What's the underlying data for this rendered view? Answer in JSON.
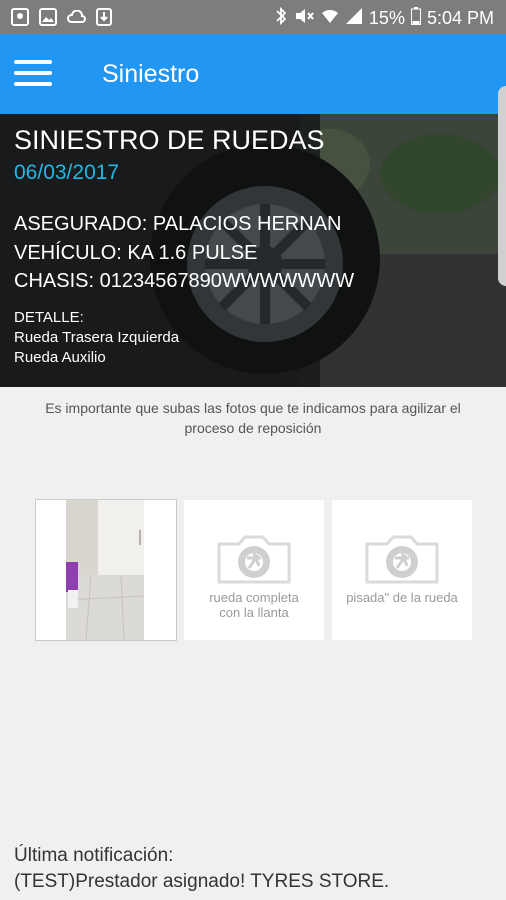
{
  "status_bar": {
    "battery": "15%",
    "time": "5:04 PM",
    "left_icons": [
      "photo-icon",
      "gallery-icon",
      "cloud-icon",
      "download-icon"
    ],
    "right_icons": [
      "bluetooth-icon",
      "mute-icon",
      "wifi-icon",
      "signal-icon",
      "battery-icon"
    ]
  },
  "app_bar": {
    "title": "Siniestro",
    "menu_icon": "hamburger-menu-icon",
    "color": "#2196f3"
  },
  "claim": {
    "title": "SINIESTRO DE RUEDAS",
    "date": "06/03/2017",
    "insured": "ASEGURADO: PALACIOS HERNAN",
    "vehicle": "VEHÍCULO: KA 1.6 PULSE",
    "chassis": "CHASIS: 01234567890WWWWWWW",
    "detail_label": "DETALLE:",
    "detail_items": [
      "Rueda Trasera Izquierda",
      "Rueda Auxilio"
    ],
    "date_color": "#23b7e5"
  },
  "info": {
    "line1": "Es importante que subas las fotos que te indicamos para agilizar el",
    "line2": "proceso de reposición"
  },
  "photos": [
    {
      "filled": true
    },
    {
      "filled": false,
      "caption_line1": "rueda completa",
      "caption_line2": "con la llanta",
      "icon": "camera-icon"
    },
    {
      "filled": false,
      "caption_line1": "pisada\" de la rueda",
      "caption_line2": "",
      "icon": "camera-icon"
    }
  ],
  "notification": {
    "label": "Última notificación:",
    "message": "(TEST)Prestador asignado! TYRES STORE."
  }
}
